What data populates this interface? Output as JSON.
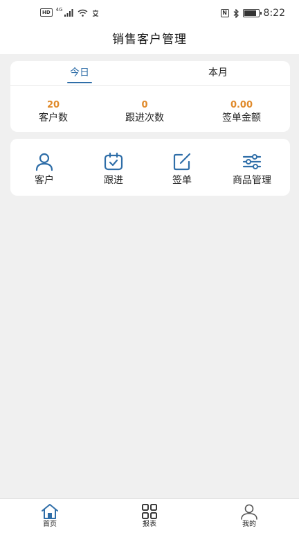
{
  "status_bar": {
    "left_badge": "HD",
    "network": "4G",
    "time": "8:22",
    "battery_level": 0.85
  },
  "header": {
    "title": "销售客户管理"
  },
  "stats_card": {
    "tabs": [
      {
        "label": "今日",
        "active": true
      },
      {
        "label": "本月",
        "active": false
      }
    ],
    "stats": [
      {
        "value": "20",
        "label": "客户数"
      },
      {
        "value": "0",
        "label": "跟进次数"
      },
      {
        "value": "0.00",
        "label": "签单金额"
      }
    ]
  },
  "menu": {
    "items": [
      {
        "label": "客户",
        "icon": "person-icon"
      },
      {
        "label": "跟进",
        "icon": "calendar-check-icon"
      },
      {
        "label": "签单",
        "icon": "edit-icon"
      },
      {
        "label": "商品管理",
        "icon": "sliders-icon"
      }
    ]
  },
  "tab_bar": {
    "items": [
      {
        "label": "首页",
        "icon": "home-icon",
        "active": true
      },
      {
        "label": "报表",
        "icon": "grid-icon",
        "active": false
      },
      {
        "label": "我的",
        "icon": "user-icon",
        "active": false
      }
    ]
  },
  "colors": {
    "accent": "#2f6ea8",
    "stat_value": "#e08a2a",
    "background": "#f0f0f0"
  }
}
